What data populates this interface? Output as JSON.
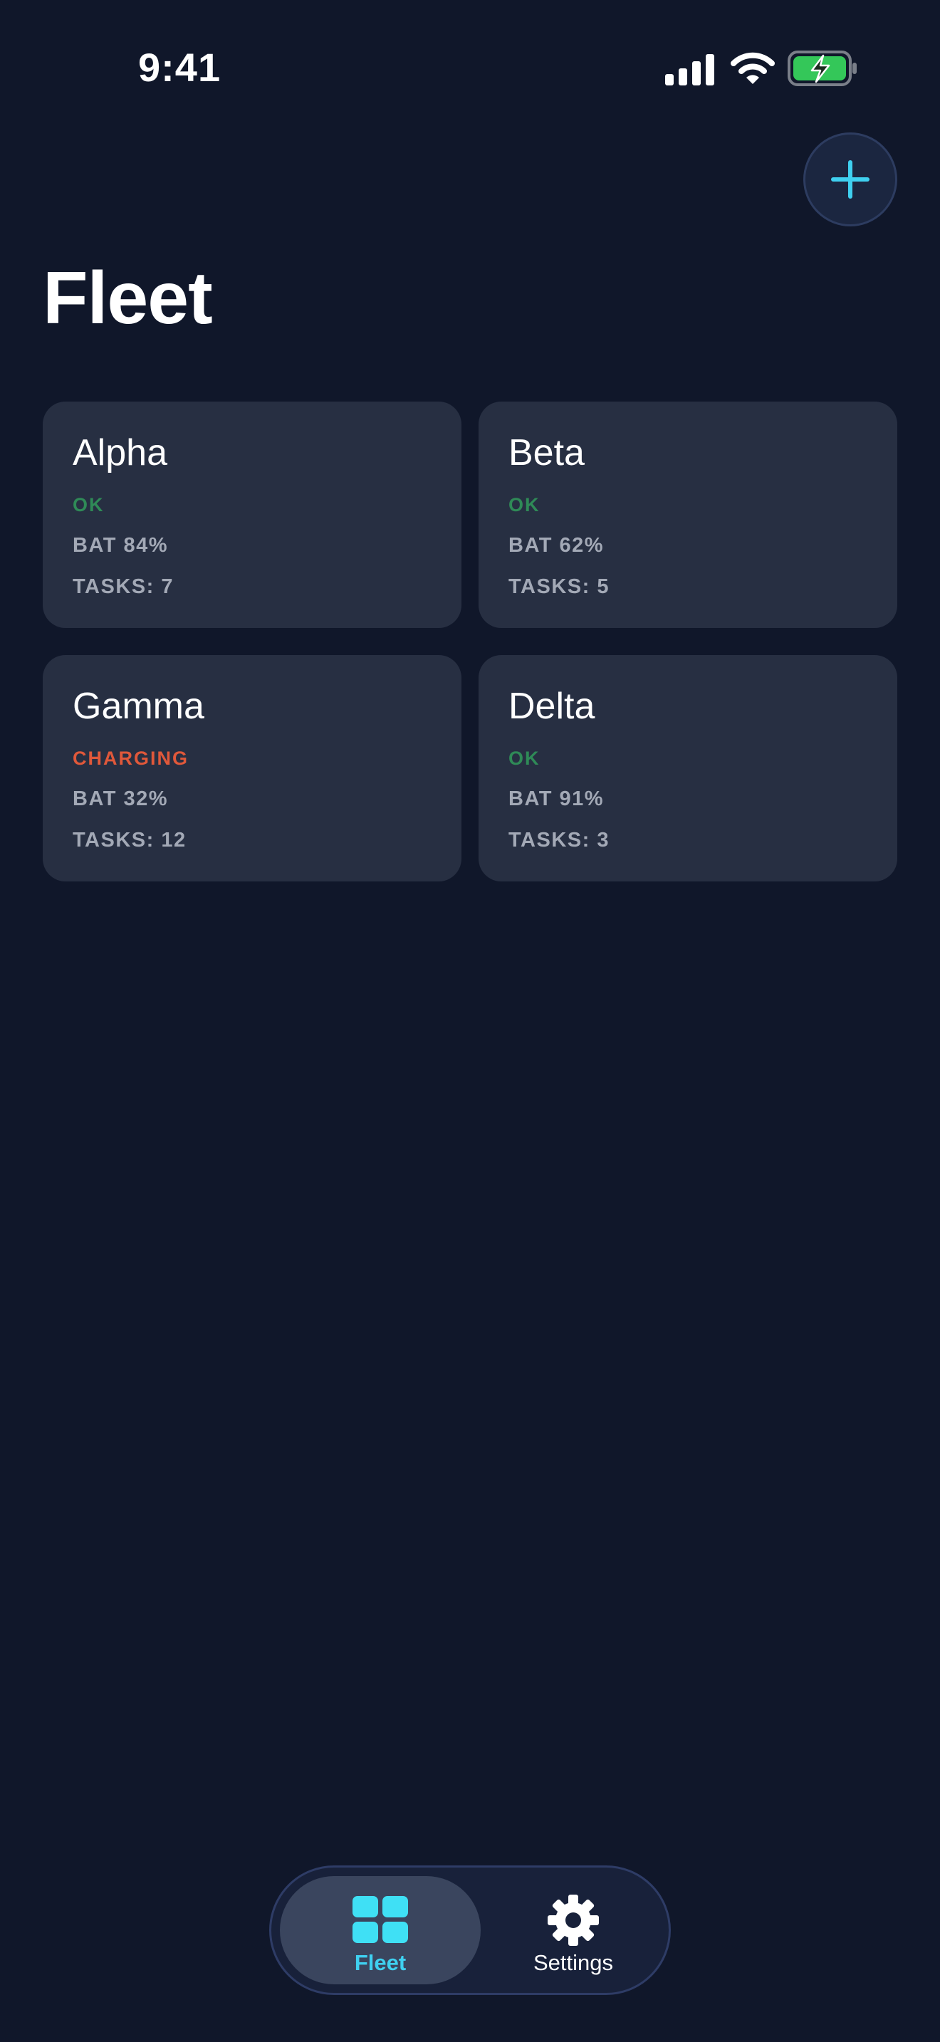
{
  "status_bar": {
    "time": "9:41"
  },
  "header": {
    "title": "Fleet",
    "add_icon": "plus-icon"
  },
  "colors": {
    "background": "#10172a",
    "card": "#272f42",
    "accent": "#3fd0f0",
    "ok": "#2f8a57",
    "charging": "#e0583a",
    "muted": "#a3a9b6"
  },
  "robots": [
    {
      "name": "Alpha",
      "status": "OK",
      "status_kind": "ok",
      "battery": "BAT 84%",
      "tasks": "TASKS: 7"
    },
    {
      "name": "Beta",
      "status": "OK",
      "status_kind": "ok",
      "battery": "BAT 62%",
      "tasks": "TASKS: 5"
    },
    {
      "name": "Gamma",
      "status": "CHARGING",
      "status_kind": "charging",
      "battery": "BAT 32%",
      "tasks": "TASKS: 12"
    },
    {
      "name": "Delta",
      "status": "OK",
      "status_kind": "ok",
      "battery": "BAT 91%",
      "tasks": "TASKS: 3"
    }
  ],
  "tab_bar": {
    "tabs": [
      {
        "label": "Fleet",
        "icon": "grid-icon",
        "selected": true
      },
      {
        "label": "Settings",
        "icon": "gear-icon",
        "selected": false
      }
    ]
  }
}
